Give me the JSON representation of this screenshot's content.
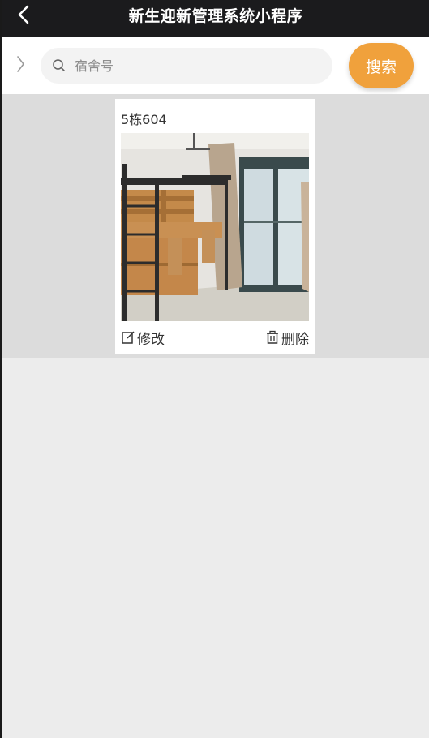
{
  "header": {
    "title": "新生迎新管理系统小程序"
  },
  "search": {
    "placeholder": "宿舍号",
    "value": "",
    "button_label": "搜索"
  },
  "dorm_cards": [
    {
      "name": "5栋604",
      "photo_icon": "dorm-room-photo",
      "edit_label": "修改",
      "delete_label": "删除"
    }
  ],
  "colors": {
    "header_bg": "#1b1b1d",
    "accent": "#f0a13c",
    "list_bg": "#dcdcdc",
    "page_bg": "#ececec"
  }
}
